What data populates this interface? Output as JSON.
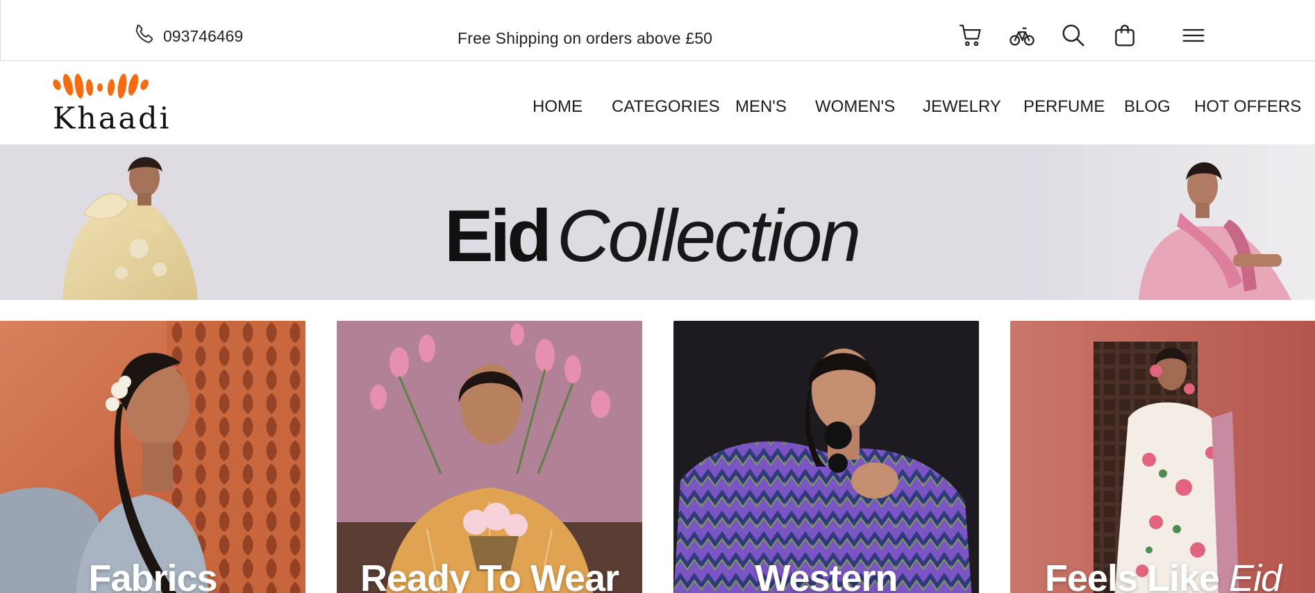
{
  "topbar": {
    "phone": "093746469",
    "shipping": "Free Shipping on orders above £50",
    "icons": [
      "cart-icon",
      "bicycle-icon",
      "search-icon",
      "shopping-bag-icon",
      "menu-icon"
    ]
  },
  "brand": {
    "name": "Khaadi",
    "accent": "#f36c12"
  },
  "nav": {
    "items": [
      "HOME",
      "CATEGORIES",
      "MEN'S",
      "WOMEN'S",
      "JEWELRY",
      "PERFUME",
      "BLOG",
      "HOT OFFERS"
    ]
  },
  "hero": {
    "title_bold": "Eid",
    "title_italic": "Collection",
    "background": "#dedbe3"
  },
  "categories": [
    {
      "label": "Fabrics",
      "label_italic": ""
    },
    {
      "label": "Ready To Wear",
      "label_italic": ""
    },
    {
      "label": "Western",
      "label_italic": ""
    },
    {
      "label": "Feels Like ",
      "label_italic": "Eid"
    }
  ]
}
